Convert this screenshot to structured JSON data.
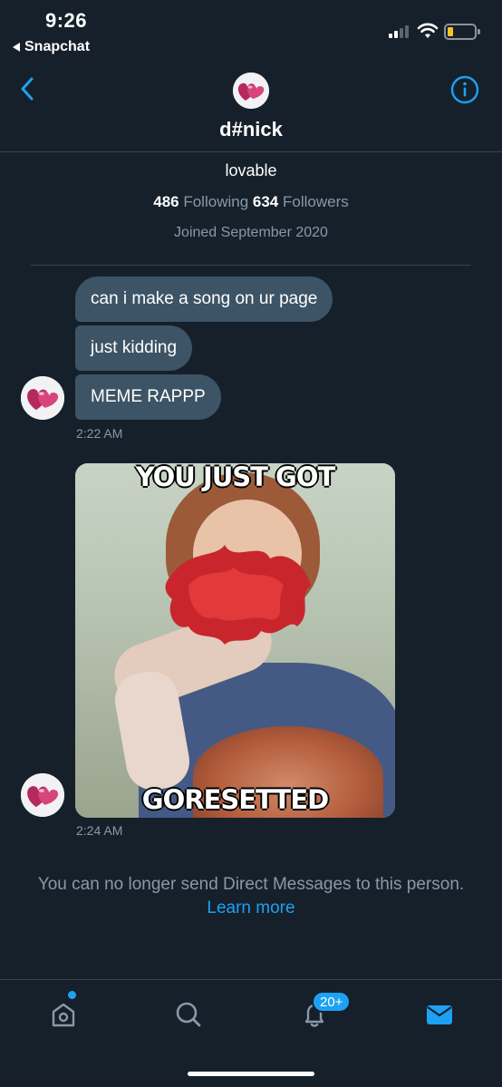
{
  "status_bar": {
    "time": "9:26",
    "back_app": "Snapchat"
  },
  "header": {
    "name": "d#nick",
    "avatar_icon": "pink-hearts-avatar",
    "back_icon": "chevron-left-icon",
    "info_icon": "info-icon"
  },
  "profile": {
    "bio": "lovable",
    "following_count": "486",
    "following_label": "Following",
    "followers_count": "634",
    "followers_label": "Followers",
    "joined": "Joined September 2020"
  },
  "messages": {
    "group1": [
      "can i make a song on ur page",
      "just kidding",
      "MEME RAPPP"
    ],
    "time1": "2:22 AM",
    "meme": {
      "top_text": "YOU JUST GOT",
      "bottom_text": "GORESETTED"
    },
    "time2": "2:24 AM"
  },
  "notice": {
    "text": "You can no longer send Direct Messages to this person.",
    "link": "Learn more"
  },
  "tabbar": {
    "notifications_badge": "20+",
    "icons": [
      "home-icon",
      "search-icon",
      "bell-icon",
      "mail-icon"
    ]
  },
  "colors": {
    "background": "#15202b",
    "bubble": "#3d5466",
    "accent": "#1da1f2",
    "muted": "#8899a6"
  }
}
